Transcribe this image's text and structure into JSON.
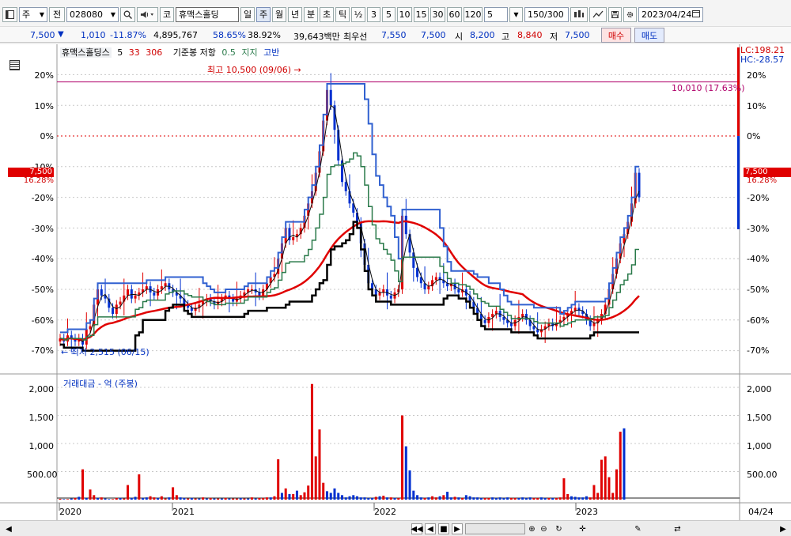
{
  "toolbar": {
    "period_selector": "주",
    "market_label": "전",
    "code": "028080",
    "company_badge": "코",
    "company": "휴맥스홀딩",
    "periods": [
      "일",
      "주",
      "월",
      "년"
    ],
    "intraday": [
      "분",
      "초",
      "틱"
    ],
    "fraction_label": "½",
    "intervals": [
      "3",
      "5",
      "10",
      "15",
      "30",
      "60",
      "120"
    ],
    "count_value": "5",
    "count_range": "150/300",
    "date": "2023/04/24"
  },
  "quote": {
    "price": "7,500",
    "price_arrow": "▼",
    "change": "1,010",
    "change_pct": "-11.87%",
    "volume": "4,895,767",
    "ratio1": "58.65%",
    "ratio2": "38.92%",
    "amount": "39,643백만",
    "lowest_label": "최우선",
    "bid1": "7,550",
    "bid2": "7,500",
    "open_label": "시",
    "open": "8,200",
    "high_label": "고",
    "high": "8,840",
    "low_label": "저",
    "low": "7,500",
    "buy_label": "매수",
    "sell_label": "매도"
  },
  "legend": {
    "name": "휴맥스홀딩스",
    "ma1": "5",
    "ma2": "33",
    "ma3": "306",
    "reference": "기준봉 저항",
    "ref_value": "0.5",
    "support": "지지",
    "high_low": "고반"
  },
  "right_info": {
    "lc": "LC:198.21",
    "hc": "HC:-28.57"
  },
  "annotations": {
    "high": "최고 10,500 (09/06)",
    "low": "최저 2,515 (06/15)",
    "ref_line": "10,010 (17.63%)",
    "current_price": "7,500",
    "current_pct": "16.28%"
  },
  "volume_panel": {
    "title": "거래대금 - 억 (주봉)"
  },
  "axis_labels": {
    "years": [
      "2020",
      "2021",
      "2022",
      "2023"
    ],
    "last_date": "04/24"
  },
  "colors": {
    "up": "#e00000",
    "down": "#0030d0",
    "ma_long": "#e00000",
    "resistance": "#000000",
    "support": "#2a7a4a",
    "high_band": "#3060d0"
  },
  "chart_data": [
    {
      "type": "candlestick",
      "title": "휴맥스홀딩스",
      "ylabel": "",
      "y_ticks": [
        "20%",
        "10%",
        "0%",
        "-10%",
        "-20%",
        "-30%",
        "-40%",
        "-50%",
        "-60%",
        "-70%"
      ],
      "ylim": [
        -73,
        25
      ],
      "reference_line": {
        "label": "10,010 (17.63%)",
        "value": 17.63
      },
      "zero_line": 0,
      "current": {
        "price": 7500,
        "pct": 16.28
      },
      "extremes": {
        "high": "최고 10,500 (09/06)",
        "low": "최저 2,515 (06/15)"
      },
      "x_labels": [
        "2020",
        "2021",
        "2022",
        "2023"
      ],
      "close_pct": [
        -66,
        -67,
        -65,
        -66,
        -67,
        -66,
        -68,
        -63,
        -62,
        -55,
        -50,
        -52,
        -53,
        -56,
        -58,
        -55,
        -54,
        -52,
        -50,
        -53,
        -52,
        -51,
        -50,
        -49,
        -51,
        -52,
        -50,
        -49,
        -48,
        -50,
        -51,
        -52,
        -53,
        -55,
        -56,
        -57,
        -56,
        -55,
        -54,
        -53,
        -54,
        -55,
        -54,
        -53,
        -52,
        -53,
        -54,
        -53,
        -52,
        -51,
        -50,
        -50,
        -51,
        -52,
        -50,
        -48,
        -46,
        -45,
        -40,
        -35,
        -30,
        -34,
        -33,
        -32,
        -30,
        -26,
        -22,
        -18,
        -12,
        -5,
        5,
        15,
        10,
        2,
        -8,
        -15,
        -18,
        -22,
        -25,
        -28,
        -35,
        -42,
        -48,
        -50,
        -52,
        -51,
        -50,
        -52,
        -53,
        -51,
        -50,
        -26,
        -32,
        -38,
        -43,
        -46,
        -48,
        -50,
        -49,
        -47,
        -46,
        -47,
        -48,
        -49,
        -48,
        -50,
        -51,
        -50,
        -52,
        -54,
        -56,
        -58,
        -60,
        -61,
        -59,
        -58,
        -57,
        -59,
        -60,
        -61,
        -62,
        -60,
        -59,
        -58,
        -60,
        -62,
        -63,
        -64,
        -63,
        -62,
        -61,
        -62,
        -61,
        -60,
        -59,
        -58,
        -57,
        -56,
        -57,
        -58,
        -60,
        -62,
        -61,
        -60,
        -58,
        -55,
        -50,
        -45,
        -40,
        -35,
        -32,
        -28,
        -22,
        -12,
        -20
      ]
    },
    {
      "type": "bar",
      "title": "거래대금 - 억 (주봉)",
      "y_ticks": [
        "2,000",
        "1,500",
        "1,000",
        "500.00"
      ],
      "ylim": [
        0,
        2200
      ],
      "values": [
        15,
        10,
        10,
        20,
        30,
        50,
        540,
        30,
        180,
        80,
        30,
        40,
        20,
        10,
        10,
        30,
        30,
        20,
        260,
        30,
        50,
        450,
        30,
        40,
        60,
        40,
        30,
        60,
        20,
        40,
        220,
        80,
        40,
        30,
        20,
        30,
        20,
        20,
        40,
        20,
        30,
        20,
        20,
        20,
        30,
        20,
        20,
        20,
        30,
        20,
        20,
        40,
        20,
        30,
        30,
        40,
        40,
        60,
        720,
        120,
        200,
        100,
        100,
        160,
        80,
        130,
        250,
        2060,
        770,
        1250,
        300,
        150,
        120,
        200,
        120,
        80,
        40,
        60,
        80,
        60,
        40,
        40,
        30,
        30,
        50,
        60,
        70,
        40,
        40,
        30,
        30,
        1500,
        950,
        520,
        160,
        80,
        40,
        30,
        40,
        60,
        40,
        60,
        80,
        140,
        40,
        50,
        40,
        30,
        80,
        60,
        40,
        40,
        30,
        30,
        30,
        40,
        30,
        40,
        30,
        40,
        30,
        30,
        30,
        40,
        30,
        40,
        30,
        30,
        40,
        30,
        30,
        30,
        30,
        40,
        380,
        100,
        60,
        50,
        40,
        40,
        60,
        40,
        260,
        120,
        710,
        770,
        400,
        120,
        540,
        1210,
        1270
      ],
      "up": [
        1,
        0,
        1,
        0,
        1,
        0,
        1,
        0,
        1,
        1,
        0,
        1,
        0,
        0,
        1,
        1,
        0,
        1,
        1,
        0,
        0,
        1,
        0,
        0,
        1,
        1,
        0,
        1,
        1,
        0,
        1,
        1,
        0,
        0,
        1,
        0,
        1,
        0,
        1,
        0,
        1,
        0,
        1,
        0,
        1,
        0,
        1,
        1,
        0,
        1,
        0,
        1,
        0,
        1,
        1,
        1,
        0,
        1,
        1,
        0,
        1,
        0,
        1,
        0,
        1,
        1,
        1,
        1,
        1,
        1,
        1,
        0,
        0,
        0,
        0,
        0,
        0,
        0,
        0,
        0,
        0,
        0,
        0,
        0,
        1,
        0,
        1,
        0,
        1,
        0,
        1,
        1,
        0,
        0,
        0,
        0,
        0,
        1,
        0,
        1,
        1,
        0,
        1,
        0,
        0,
        1,
        0,
        1,
        0,
        0,
        0,
        0,
        0,
        1,
        1,
        0,
        0,
        0,
        0,
        0,
        1,
        1,
        0,
        0,
        0,
        0,
        1,
        1,
        0,
        0,
        1,
        0,
        1,
        1,
        1,
        1,
        0,
        0,
        0,
        0,
        0,
        1,
        1,
        1,
        1,
        1,
        1,
        1,
        1,
        1,
        0,
        1,
        0
      ]
    }
  ]
}
